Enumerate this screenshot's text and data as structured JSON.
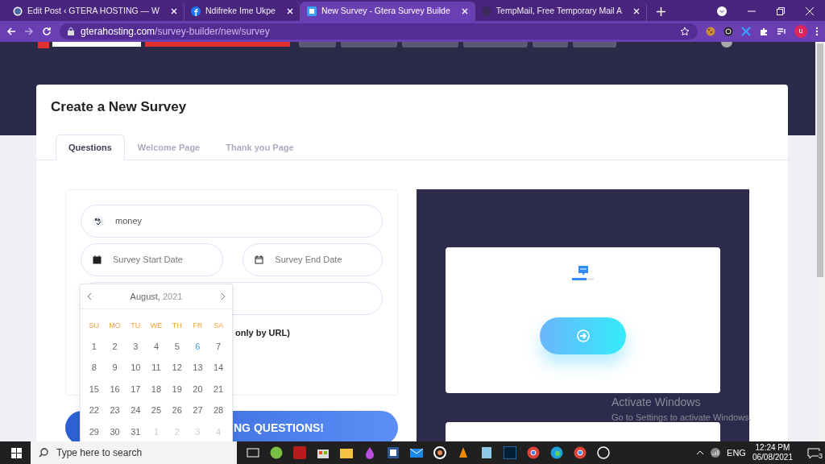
{
  "browser": {
    "tabs": [
      {
        "title": "Edit Post ‹ GTERA HOSTING — W",
        "selected": false
      },
      {
        "title": "Ndifreke Ime Ukpe",
        "selected": false
      },
      {
        "title": "New Survey - Gtera Survey Builde",
        "selected": true
      },
      {
        "title": "TempMail, Free Temporary Mail A",
        "selected": false
      }
    ],
    "url": {
      "host": "gterahosting.com",
      "path": "/survey-builder/new/survey"
    },
    "profile_initial": "u"
  },
  "page": {
    "title": "Create a New Survey",
    "tabs": [
      {
        "label": "Questions",
        "selected": true
      },
      {
        "label": "Welcome Page",
        "selected": false
      },
      {
        "label": "Thank you Page",
        "selected": false
      }
    ],
    "form": {
      "title_value": "money",
      "start_date_placeholder": "Survey Start Date",
      "end_date_placeholder": "Survey End Date",
      "note": "only by URL)",
      "submit_label": "NG QUESTIONS!"
    },
    "datepicker": {
      "month": "August,",
      "year": "2021",
      "weekdays": [
        "SU",
        "MO",
        "TU",
        "WE",
        "TH",
        "FR",
        "SA"
      ],
      "days": [
        {
          "label": "1",
          "kind": "current"
        },
        {
          "label": "2",
          "kind": "current"
        },
        {
          "label": "3",
          "kind": "current"
        },
        {
          "label": "4",
          "kind": "current"
        },
        {
          "label": "5",
          "kind": "current"
        },
        {
          "label": "6",
          "kind": "today"
        },
        {
          "label": "7",
          "kind": "current"
        },
        {
          "label": "8",
          "kind": "current"
        },
        {
          "label": "9",
          "kind": "current"
        },
        {
          "label": "10",
          "kind": "current"
        },
        {
          "label": "11",
          "kind": "current"
        },
        {
          "label": "12",
          "kind": "current"
        },
        {
          "label": "13",
          "kind": "current"
        },
        {
          "label": "14",
          "kind": "current"
        },
        {
          "label": "15",
          "kind": "current"
        },
        {
          "label": "16",
          "kind": "current"
        },
        {
          "label": "17",
          "kind": "current"
        },
        {
          "label": "18",
          "kind": "current"
        },
        {
          "label": "19",
          "kind": "current"
        },
        {
          "label": "20",
          "kind": "current"
        },
        {
          "label": "21",
          "kind": "current"
        },
        {
          "label": "22",
          "kind": "current"
        },
        {
          "label": "23",
          "kind": "current"
        },
        {
          "label": "24",
          "kind": "current"
        },
        {
          "label": "25",
          "kind": "current"
        },
        {
          "label": "26",
          "kind": "current"
        },
        {
          "label": "27",
          "kind": "current"
        },
        {
          "label": "28",
          "kind": "current"
        },
        {
          "label": "29",
          "kind": "current"
        },
        {
          "label": "30",
          "kind": "current"
        },
        {
          "label": "31",
          "kind": "current"
        },
        {
          "label": "1",
          "kind": "other"
        },
        {
          "label": "2",
          "kind": "other"
        },
        {
          "label": "3",
          "kind": "other"
        },
        {
          "label": "4",
          "kind": "other"
        }
      ]
    },
    "preview": {
      "progress": {
        "level": 0.65
      }
    }
  },
  "activation": {
    "title": "Activate Windows",
    "subtitle": "Go to Settings to activate Windows."
  },
  "taskbar": {
    "search_placeholder": "Type here to search",
    "language": "ENG",
    "time": "12:24 PM",
    "date": "06/08/2021",
    "notifications": "3"
  }
}
